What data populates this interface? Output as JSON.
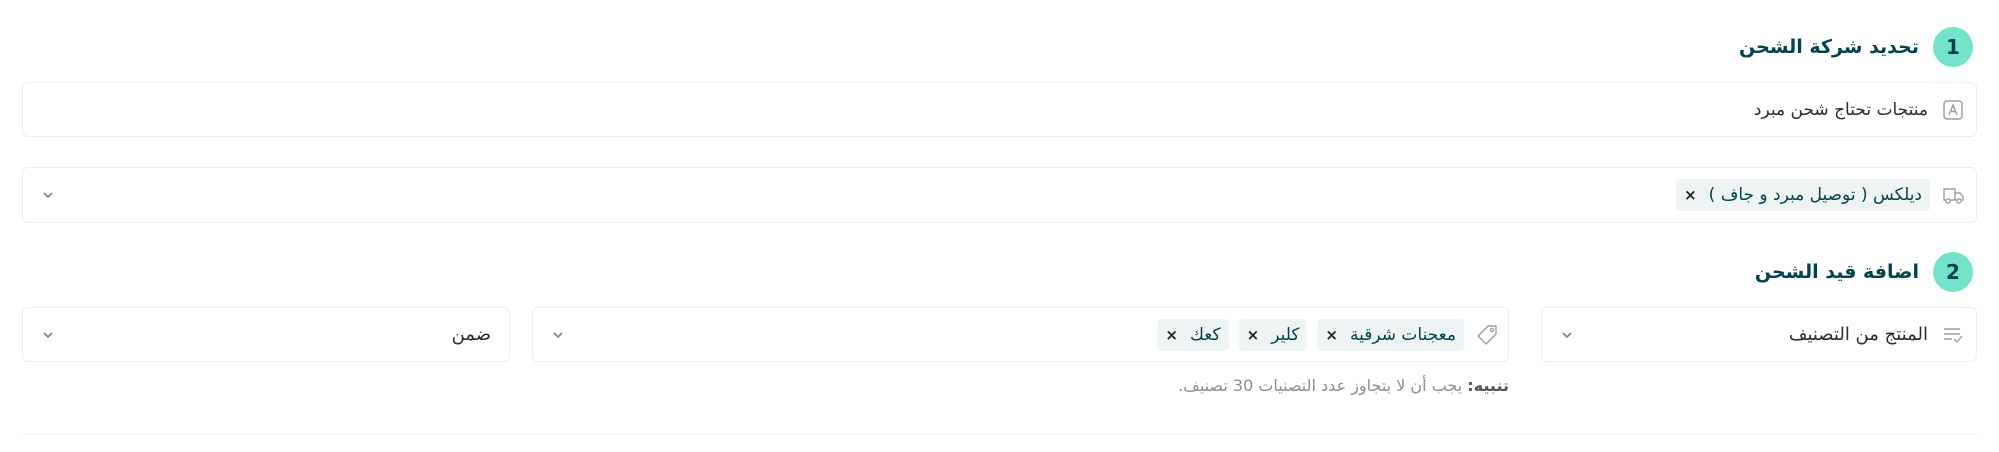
{
  "step1": {
    "number": "1",
    "title": "تحديد شركة الشحن",
    "option_text": "منتجات تحتاج شحن مبرد",
    "option_icon": "letter-a-box-icon",
    "carrier_icon": "truck-icon",
    "carriers": [
      {
        "label": "ديلكس ( توصيل مبرد و جاف )",
        "remove": "×"
      }
    ]
  },
  "step2": {
    "number": "2",
    "title": "اضافة قيد الشحن",
    "type_select": {
      "value": "المنتج من التصنيف",
      "icon": "list-check-icon"
    },
    "categories_icon": "tag-icon",
    "categories": [
      {
        "label": "معجنات شرقية",
        "remove": "×"
      },
      {
        "label": "كلير",
        "remove": "×"
      },
      {
        "label": "كعك",
        "remove": "×"
      }
    ],
    "condition_select": {
      "value": "ضمن"
    },
    "note_label": "تنبيه:",
    "note_text": " يجب أن لا يتجاوز عدد التصنيات 30 تصنيف."
  },
  "colors": {
    "badge": "#74e3cc",
    "title": "#00434f",
    "tag_bg": "#eef4f4",
    "border": "#ebeef0"
  }
}
